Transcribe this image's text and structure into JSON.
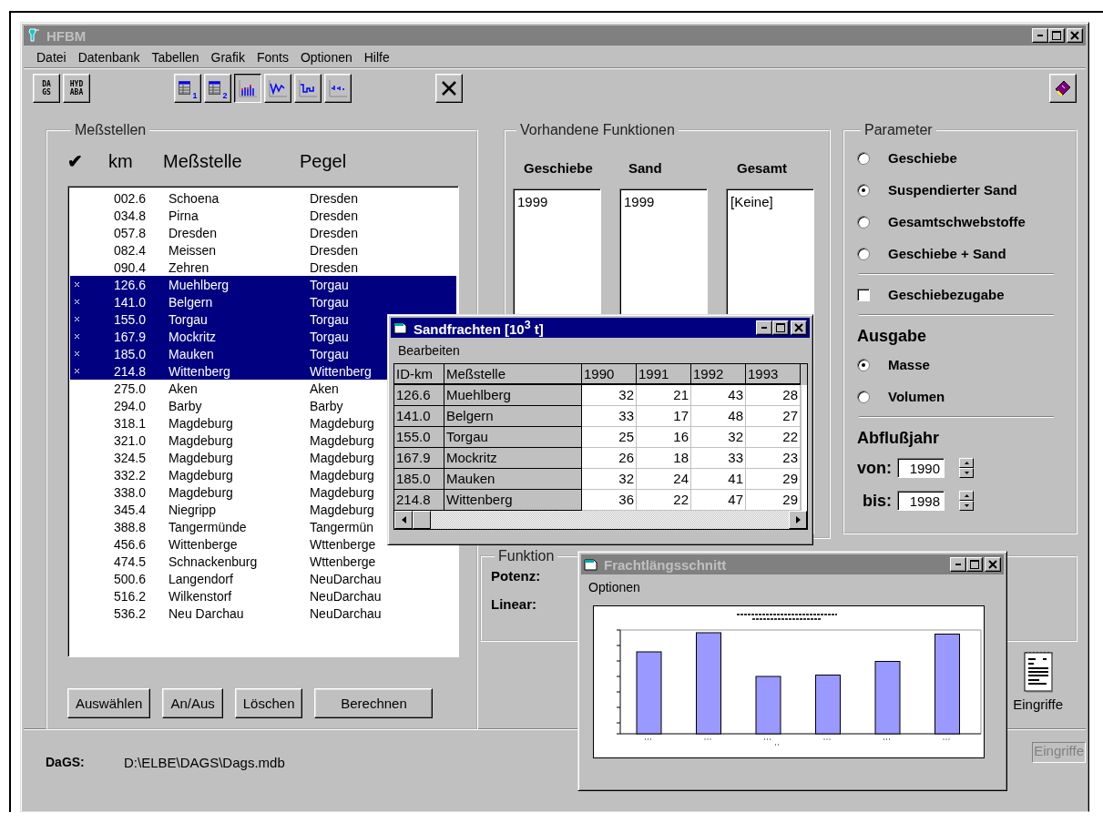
{
  "window": {
    "title": "HFBM",
    "active": false
  },
  "menu": [
    {
      "label": "Datei"
    },
    {
      "label": "Datenbank"
    },
    {
      "label": "Tabellen"
    },
    {
      "label": "Grafik"
    },
    {
      "label": "Fonts"
    },
    {
      "label": "Optionen"
    },
    {
      "label": "Hilfe"
    }
  ],
  "toolbar": [
    [
      {
        "kind": "text",
        "lines": [
          "DA",
          "GS"
        ],
        "pressed": false
      },
      {
        "kind": "text",
        "lines": [
          "HYD",
          "ABA"
        ],
        "pressed": false
      }
    ],
    [
      {
        "kind": "table",
        "sub": "1",
        "pressed": false
      },
      {
        "kind": "table",
        "sub": "2",
        "pressed": false
      },
      {
        "kind": "bars",
        "pressed": true
      },
      {
        "kind": "zigzag",
        "pressed": false
      },
      {
        "kind": "steps",
        "pressed": false
      },
      {
        "kind": "dots",
        "pressed": false
      }
    ],
    [
      {
        "kind": "close",
        "pressed": false
      }
    ]
  ],
  "toolbar_right": [
    {
      "kind": "book",
      "pressed": false
    }
  ],
  "stations": {
    "title": "Meßstellen",
    "check": "✔",
    "columns": [
      "km",
      "Meßstelle",
      "Pegel"
    ],
    "rows": [
      {
        "km": "002.6",
        "name": "Schoena",
        "gauge": "Dresden",
        "selected": false
      },
      {
        "km": "034.8",
        "name": "Pirna",
        "gauge": "Dresden",
        "selected": false
      },
      {
        "km": "057.8",
        "name": "Dresden",
        "gauge": "Dresden",
        "selected": false
      },
      {
        "km": "082.4",
        "name": "Meissen",
        "gauge": "Dresden",
        "selected": false
      },
      {
        "km": "090.4",
        "name": "Zehren",
        "gauge": "Dresden",
        "selected": false
      },
      {
        "km": "126.6",
        "name": "Muehlberg",
        "gauge": "Torgau",
        "selected": true
      },
      {
        "km": "141.0",
        "name": "Belgern",
        "gauge": "Torgau",
        "selected": true
      },
      {
        "km": "155.0",
        "name": "Torgau",
        "gauge": "Torgau",
        "selected": true
      },
      {
        "km": "167.9",
        "name": "Mockritz",
        "gauge": "Torgau",
        "selected": true
      },
      {
        "km": "185.0",
        "name": "Mauken",
        "gauge": "Torgau",
        "selected": true
      },
      {
        "km": "214.8",
        "name": "Wittenberg",
        "gauge": "Wittenberg",
        "selected": true
      },
      {
        "km": "275.0",
        "name": "Aken",
        "gauge": "Aken",
        "selected": false
      },
      {
        "km": "294.0",
        "name": "Barby",
        "gauge": "Barby",
        "selected": false
      },
      {
        "km": "318.1",
        "name": "Magdeburg",
        "gauge": "Magdeburg",
        "selected": false
      },
      {
        "km": "321.0",
        "name": "Magdeburg",
        "gauge": "Magdeburg",
        "selected": false
      },
      {
        "km": "324.5",
        "name": "Magdeburg",
        "gauge": "Magdeburg",
        "selected": false
      },
      {
        "km": "332.2",
        "name": "Magdeburg",
        "gauge": "Magdeburg",
        "selected": false
      },
      {
        "km": "338.0",
        "name": "Magdeburg",
        "gauge": "Magdeburg",
        "selected": false
      },
      {
        "km": "345.4",
        "name": "Niegripp",
        "gauge": "Magdeburg",
        "selected": false
      },
      {
        "km": "388.8",
        "name": "Tangermünde",
        "gauge": "Tangermün",
        "selected": false
      },
      {
        "km": "456.6",
        "name": "Wittenberge",
        "gauge": "Wttenberge",
        "selected": false
      },
      {
        "km": "474.5",
        "name": "Schnackenburg",
        "gauge": "Wttenberge",
        "selected": false
      },
      {
        "km": "500.6",
        "name": "Langendorf",
        "gauge": "NeuDarchau",
        "selected": false
      },
      {
        "km": "516.2",
        "name": "Wilkenstorf",
        "gauge": "NeuDarchau",
        "selected": false
      },
      {
        "km": "536.2",
        "name": "Neu Darchau",
        "gauge": "NeuDarchau",
        "selected": false
      }
    ],
    "buttons": [
      {
        "label": "Auswählen"
      },
      {
        "label": "An/Aus"
      },
      {
        "label": "Löschen"
      },
      {
        "label": "Berechnen"
      }
    ]
  },
  "functions": {
    "title": "Vorhandene Funktionen",
    "columns": [
      {
        "heading": "Geschiebe",
        "items": [
          "1999"
        ]
      },
      {
        "heading": "Sand",
        "items": [
          "1999"
        ]
      },
      {
        "heading": "Gesamt",
        "items": [
          "[Keine]"
        ]
      }
    ]
  },
  "function_fit": {
    "title": "Funktion",
    "rows": [
      "Potenz:",
      "Linear:"
    ]
  },
  "parameter": {
    "title": "Parameter",
    "types": [
      {
        "label": "Geschiebe",
        "selected": false
      },
      {
        "label": "Suspendierter Sand",
        "selected": true
      },
      {
        "label": "Gesamtschwebstoffe",
        "selected": false
      },
      {
        "label": "Geschiebe + Sand",
        "selected": false
      }
    ],
    "addition": {
      "label": "Geschiebezugabe",
      "checked": false
    },
    "output": {
      "heading": "Ausgabe",
      "options": [
        {
          "label": "Masse",
          "selected": true
        },
        {
          "label": "Volumen",
          "selected": false
        }
      ]
    },
    "year": {
      "heading": "Abflußjahr",
      "from": {
        "label": "von:",
        "value": "1990"
      },
      "to": {
        "label": "bis:",
        "value": "1998"
      }
    }
  },
  "interventions": {
    "label": "Eingriffe"
  },
  "interventions_field": {
    "value": "Eingriffe",
    "disabled": true
  },
  "status": [
    {
      "label": "DaGS:",
      "value": "D:\\ELBE\\DAGS\\Dags.mdb"
    }
  ],
  "sand_loads": {
    "title": "Sandfrachten [10$^{3}$ t]",
    "active": true,
    "menu": [
      {
        "label": "Bearbeiten"
      }
    ],
    "columns": [
      "ID-km",
      "Meßstelle",
      "1990",
      "1991",
      "1992",
      "1993"
    ],
    "rows": [
      [
        "126.6",
        "Muehlberg",
        "32",
        "21",
        "43",
        "28"
      ],
      [
        "141.0",
        "Belgern",
        "33",
        "17",
        "48",
        "27"
      ],
      [
        "155.0",
        "Torgau",
        "25",
        "16",
        "32",
        "22"
      ],
      [
        "167.9",
        "Mockritz",
        "26",
        "18",
        "33",
        "23"
      ],
      [
        "185.0",
        "Mauken",
        "32",
        "24",
        "41",
        "29"
      ],
      [
        "214.8",
        "Wittenberg",
        "36",
        "22",
        "47",
        "29"
      ]
    ]
  },
  "profile_window": {
    "title": "Frachtlängsschnitt",
    "active": false,
    "menu": [
      {
        "label": "Optionen"
      }
    ]
  }
}
